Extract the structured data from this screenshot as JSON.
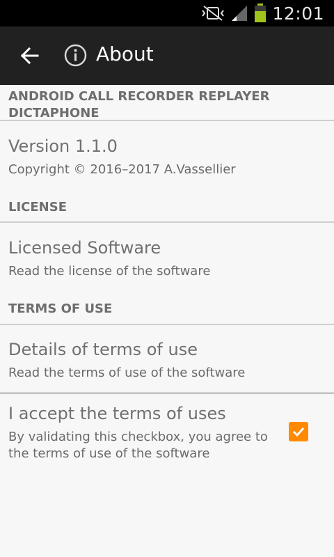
{
  "status_bar": {
    "time": "12:01",
    "icons": [
      "vibrate-off-icon",
      "signal-icon",
      "battery-icon"
    ],
    "battery_color": "#9ec41b"
  },
  "toolbar": {
    "title": "About",
    "back_icon": "arrow-left-icon",
    "info_icon": "info-icon"
  },
  "app_section": {
    "header": "ANDROID CALL RECORDER REPLAYER DICTAPHONE",
    "version_title": "Version 1.1.0",
    "copyright": "Copyright © 2016–2017 A.Vassellier"
  },
  "license_section": {
    "header": "LICENSE",
    "title": "Licensed Software",
    "summary": "Read the license of the software"
  },
  "terms_section": {
    "header": "TERMS OF USE",
    "details_title": "Details of terms of use",
    "details_summary": "Read the terms of use of the software",
    "accept_title": "I accept the terms of uses",
    "accept_summary": "By validating this checkbox, you agree to the terms of use of the software",
    "accept_checked": true
  },
  "colors": {
    "accent": "#ff8a00",
    "toolbar": "#212121",
    "background": "#f7f7f7"
  }
}
